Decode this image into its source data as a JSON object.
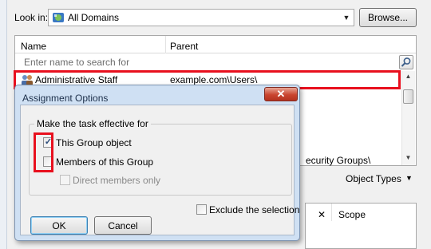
{
  "colors": {
    "highlight": "#e8101e",
    "dialog_frame": "#cfe0f3",
    "close_button": "#c9452f"
  },
  "picker": {
    "look_in_label": "Look in:",
    "domain_value": "All Domains",
    "browse_label": "Browse...",
    "columns": {
      "name": "Name",
      "parent": "Parent"
    },
    "search_placeholder": "Enter name to search for",
    "rows": [
      {
        "name": "Administrative Staff",
        "parent": "example.com\\Users\\",
        "icon": "group-icon"
      }
    ],
    "peek_text": "ecurity Groups\\",
    "object_types_label": "Object Types",
    "bottom_columns": {
      "x": "✕",
      "scope": "Scope"
    }
  },
  "dialog": {
    "title": "Assignment Options",
    "close_glyph": "✕",
    "group_legend": "Make the task effective for",
    "options": {
      "this_group": {
        "label": "This Group object",
        "checked": true
      },
      "members": {
        "label": "Members of this Group",
        "checked": false
      },
      "direct": {
        "label": "Direct members only",
        "checked": false,
        "enabled": false
      }
    },
    "exclude_label": "Exclude the selection",
    "ok_label": "OK",
    "cancel_label": "Cancel"
  }
}
